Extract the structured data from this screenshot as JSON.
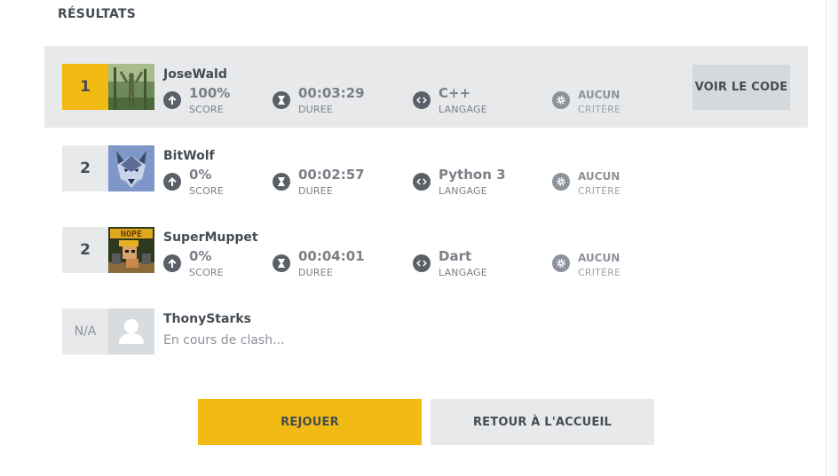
{
  "page": {
    "title": "RÉSULTATS"
  },
  "labels": {
    "score": "SCORE",
    "duration": "DUREE",
    "language": "LANGAGE",
    "criterion": "CRITÈRE",
    "view_code": "VOIR LE CODE"
  },
  "icons": {
    "score": "arrow-up-icon",
    "duration": "hourglass-icon",
    "language": "code-icon",
    "criterion": "gear-icon"
  },
  "colors": {
    "accent": "#f2bb13",
    "row_highlight": "#e7e9eb",
    "icon_bg": "#5b6068",
    "text": "#454c55",
    "muted": "#7b8087"
  },
  "players": [
    {
      "rank": "1",
      "name": "JoseWald",
      "score": "100%",
      "duration": "00:03:29",
      "language": "C++",
      "criterion": "AUCUN"
    },
    {
      "rank": "2",
      "name": "BitWolf",
      "score": "0%",
      "duration": "00:02:57",
      "language": "Python 3",
      "criterion": "AUCUN"
    },
    {
      "rank": "2",
      "name": "SuperMuppet",
      "avatar_text": "NOPE",
      "score": "0%",
      "duration": "00:04:01",
      "language": "Dart",
      "criterion": "AUCUN"
    },
    {
      "rank": "N/A",
      "name": "ThonyStarks",
      "status": "En cours de clash..."
    }
  ],
  "actions": {
    "replay": "REJOUER",
    "home": "RETOUR À L'ACCUEIL"
  }
}
